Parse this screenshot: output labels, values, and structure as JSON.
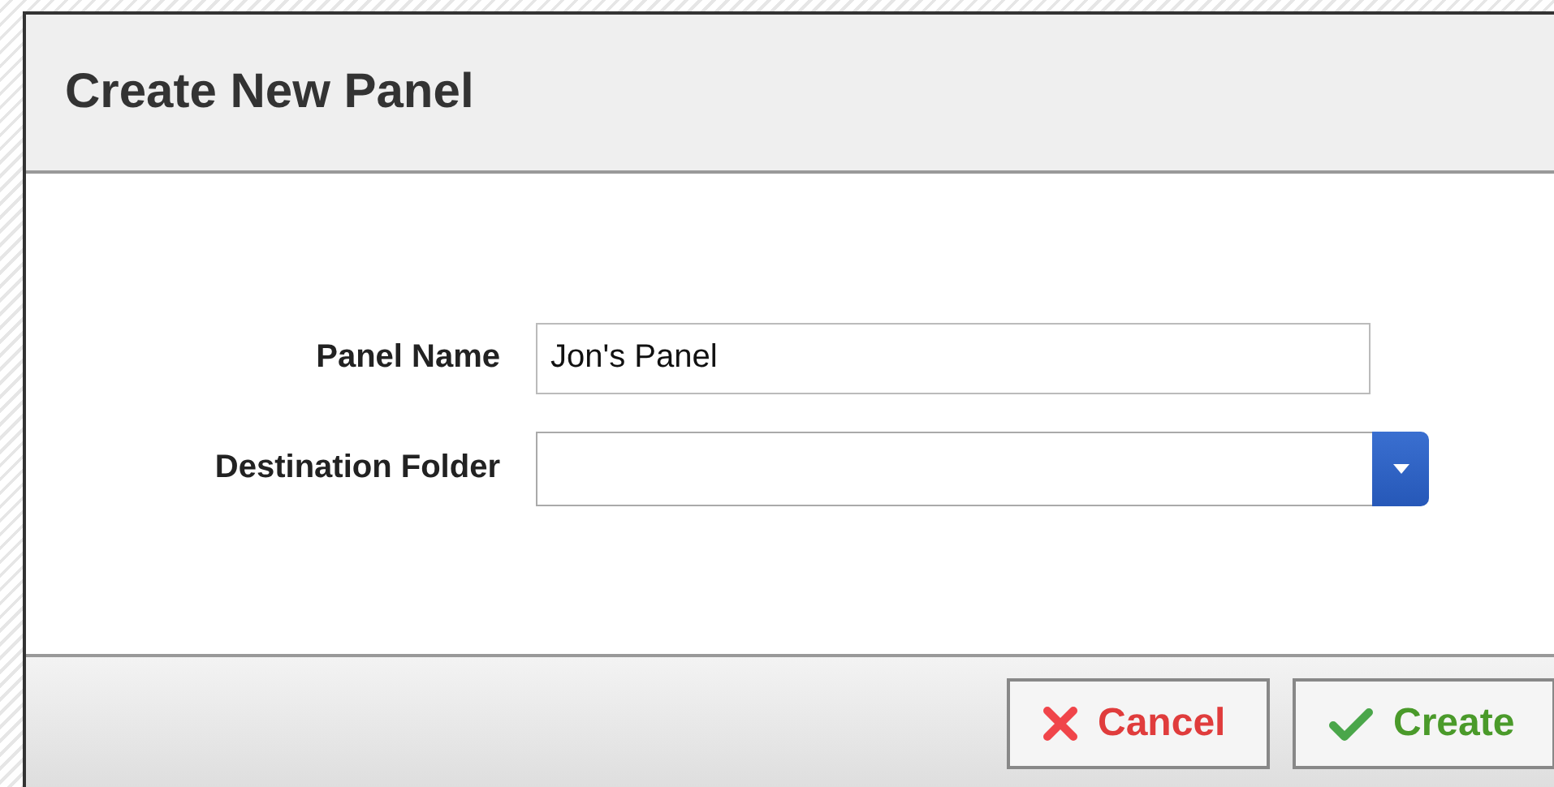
{
  "dialog": {
    "title": "Create New Panel"
  },
  "fields": [
    {
      "kind": "text",
      "label": "Panel Name",
      "value": "Jon's Panel"
    },
    {
      "kind": "dropdown",
      "label": "Destination Folder"
    }
  ],
  "buttons": [
    {
      "kind": "cancel",
      "label": "Cancel"
    },
    {
      "kind": "confirm",
      "label": "Create"
    }
  ]
}
